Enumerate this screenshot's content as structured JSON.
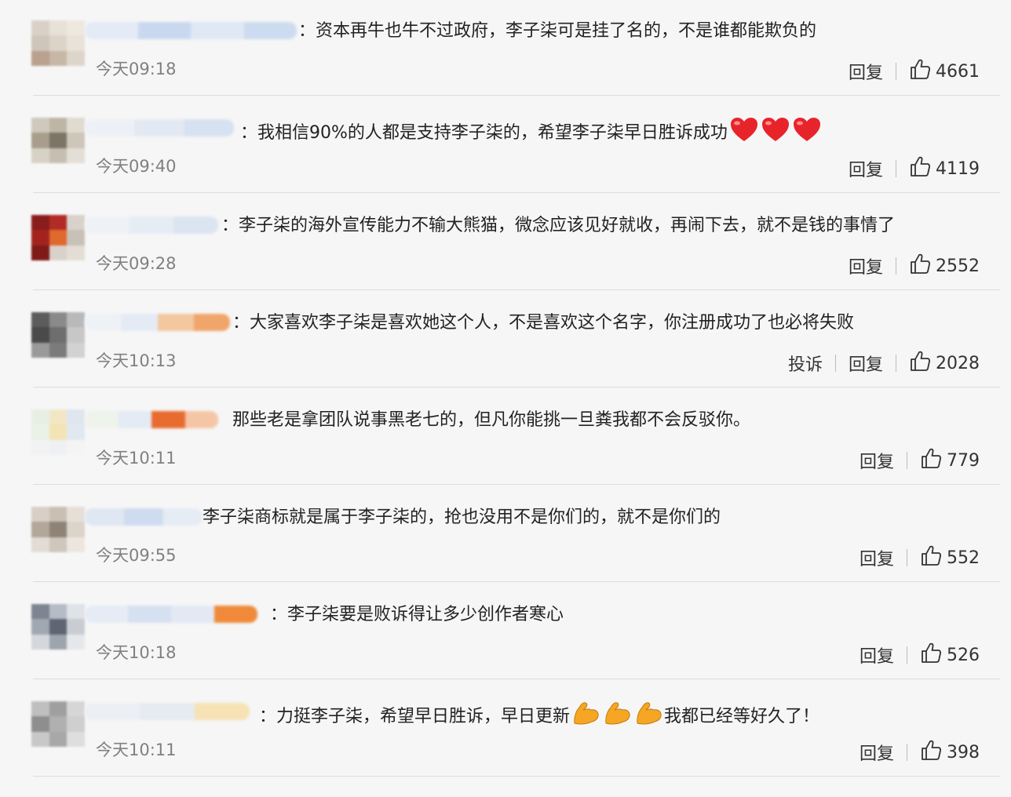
{
  "comments": [
    {
      "text": "：资本再牛也牛不过政府，李子柒可是挂了名的，不是谁都能欺负的",
      "emoji": "",
      "emoji_count": 0,
      "time": "今天09:18",
      "actions": [
        "回复"
      ],
      "likes": "4661"
    },
    {
      "text": "：我相信90%的人都是支持李子柒的，希望李子柒早日胜诉成功",
      "emoji": "heart-icon",
      "emoji_count": 3,
      "time": "今天09:40",
      "actions": [
        "回复"
      ],
      "likes": "4119"
    },
    {
      "text": "：李子柒的海外宣传能力不输大熊猫，微念应该见好就收，再闹下去，就不是钱的事情了",
      "emoji": "",
      "emoji_count": 0,
      "time": "今天09:28",
      "actions": [
        "回复"
      ],
      "likes": "2552"
    },
    {
      "text": "：大家喜欢李子柒是喜欢她这个人，不是喜欢这个名字，你注册成功了也必将失败",
      "emoji": "",
      "emoji_count": 0,
      "time": "今天10:13",
      "actions": [
        "投诉",
        "回复"
      ],
      "likes": "2028"
    },
    {
      "text": "那些老是拿团队说事黑老七的，但凡你能挑一旦粪我都不会反驳你。",
      "emoji": "",
      "emoji_count": 0,
      "time": "今天10:11",
      "actions": [
        "回复"
      ],
      "likes": "779"
    },
    {
      "text": "李子柒商标就是属于李子柒的，抢也没用不是你们的，就不是你们的",
      "emoji": "",
      "emoji_count": 0,
      "time": "今天09:55",
      "actions": [
        "回复"
      ],
      "likes": "552"
    },
    {
      "text": "：李子柒要是败诉得让多少创作者寒心",
      "emoji": "",
      "emoji_count": 0,
      "time": "今天10:18",
      "actions": [
        "回复"
      ],
      "likes": "526"
    },
    {
      "text": "：力挺李子柒，希望早日胜诉，早日更新",
      "emoji": "muscle-icon",
      "emoji_count": 3,
      "text_after": "我都已经等好久了！",
      "time": "今天10:11",
      "actions": [
        "回复"
      ],
      "likes": "398"
    }
  ],
  "colors": {
    "heart": "#e8242b",
    "muscle": "#f5a623",
    "like_icon": "#333333",
    "time": "#808080"
  }
}
